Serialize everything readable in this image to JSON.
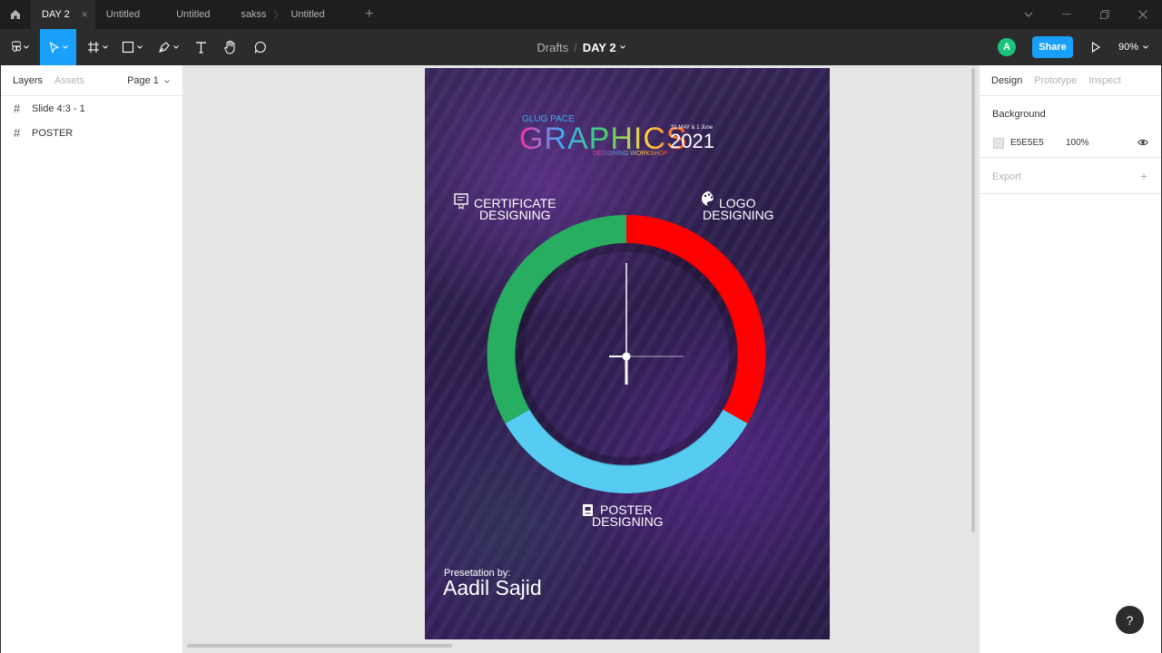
{
  "tabs": {
    "items": [
      {
        "label": "DAY 2",
        "active": true
      },
      {
        "label": "Untitled",
        "active": false
      },
      {
        "label": "Untitled",
        "active": false
      },
      {
        "label": "sakss",
        "active": false
      },
      {
        "label": "Untitled",
        "active": false
      }
    ],
    "close_glyph": "×",
    "sep_glyph": "〉",
    "add_glyph": "+"
  },
  "toolbar": {
    "crumb_drafts": "Drafts",
    "crumb_slash": "/",
    "crumb_file": "DAY 2",
    "avatar_initial": "A",
    "share_label": "Share",
    "zoom_label": "90%",
    "accent": "#18a0fb"
  },
  "left_panel": {
    "tab_layers": "Layers",
    "tab_assets": "Assets",
    "page_label": "Page 1",
    "layers": [
      "Slide 4:3 - 1",
      "POSTER"
    ],
    "hash_glyph": "#"
  },
  "poster": {
    "brand_small": "GLUG PACE",
    "title": "GRAPHICS",
    "dates": "31 MAY & 1 June",
    "year": "2021",
    "workshop": "DESIGNING WORKSHOP",
    "certificate": {
      "line1": "CERTIFICATE",
      "line2": "DESIGNING"
    },
    "logo": {
      "line1": "LOGO",
      "line2": "DESIGNING"
    },
    "poster_topic": {
      "line1": "POSTER",
      "line2": "DESIGNING"
    },
    "presented_by": "Presetation by:",
    "presenter": "Aadil Sajid",
    "ring_colors": {
      "green": "#27ae60",
      "red": "#ff0000",
      "blue": "#56ccf2"
    }
  },
  "right_panel": {
    "tab_design": "Design",
    "tab_prototype": "Prototype",
    "tab_inspect": "Inspect",
    "background_title": "Background",
    "background_hex": "E5E5E5",
    "background_opacity": "100%",
    "export_title": "Export",
    "export_plus": "+",
    "help_glyph": "?"
  }
}
